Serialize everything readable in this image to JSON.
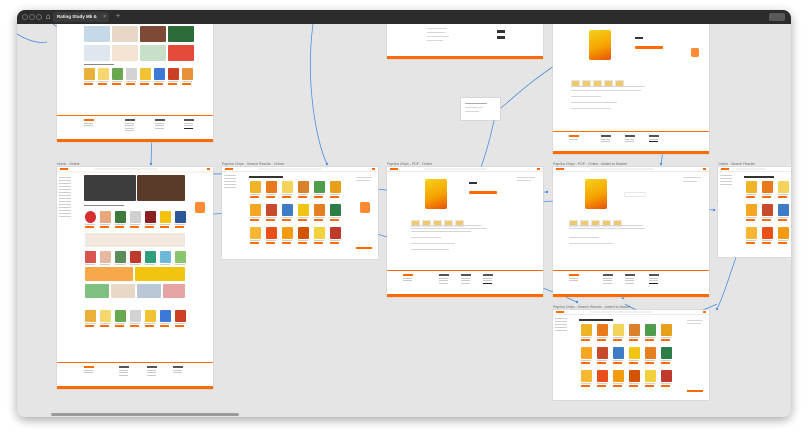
{
  "window": {
    "document_tab": "Rating Study Mk &",
    "traffic_light_color": "#6a6a6a",
    "home_icon": "home-icon",
    "close_icon": "close-icon",
    "new_tab_icon": "plus-icon"
  },
  "frames": [
    {
      "id": "home-top",
      "label": ""
    },
    {
      "id": "home-online",
      "label": "Home - Online"
    },
    {
      "id": "search-chips",
      "label": "Paprika Chips - Search Results - Online"
    },
    {
      "id": "pdp-top",
      "label": ""
    },
    {
      "id": "pdp-online",
      "label": "Paprika Chips - PDP - Online"
    },
    {
      "id": "pdp-basket-top",
      "label": ""
    },
    {
      "id": "pdp-basket",
      "label": "Paprika Chips - PDP - Online - Added to Basket"
    },
    {
      "id": "search-basket",
      "label": "Paprika Chips - Search Results - Added to Basket"
    },
    {
      "id": "search-right",
      "label": "Online - Search Results"
    }
  ],
  "brand_color": "#ff6b00",
  "wire_color": "#4a90e2"
}
